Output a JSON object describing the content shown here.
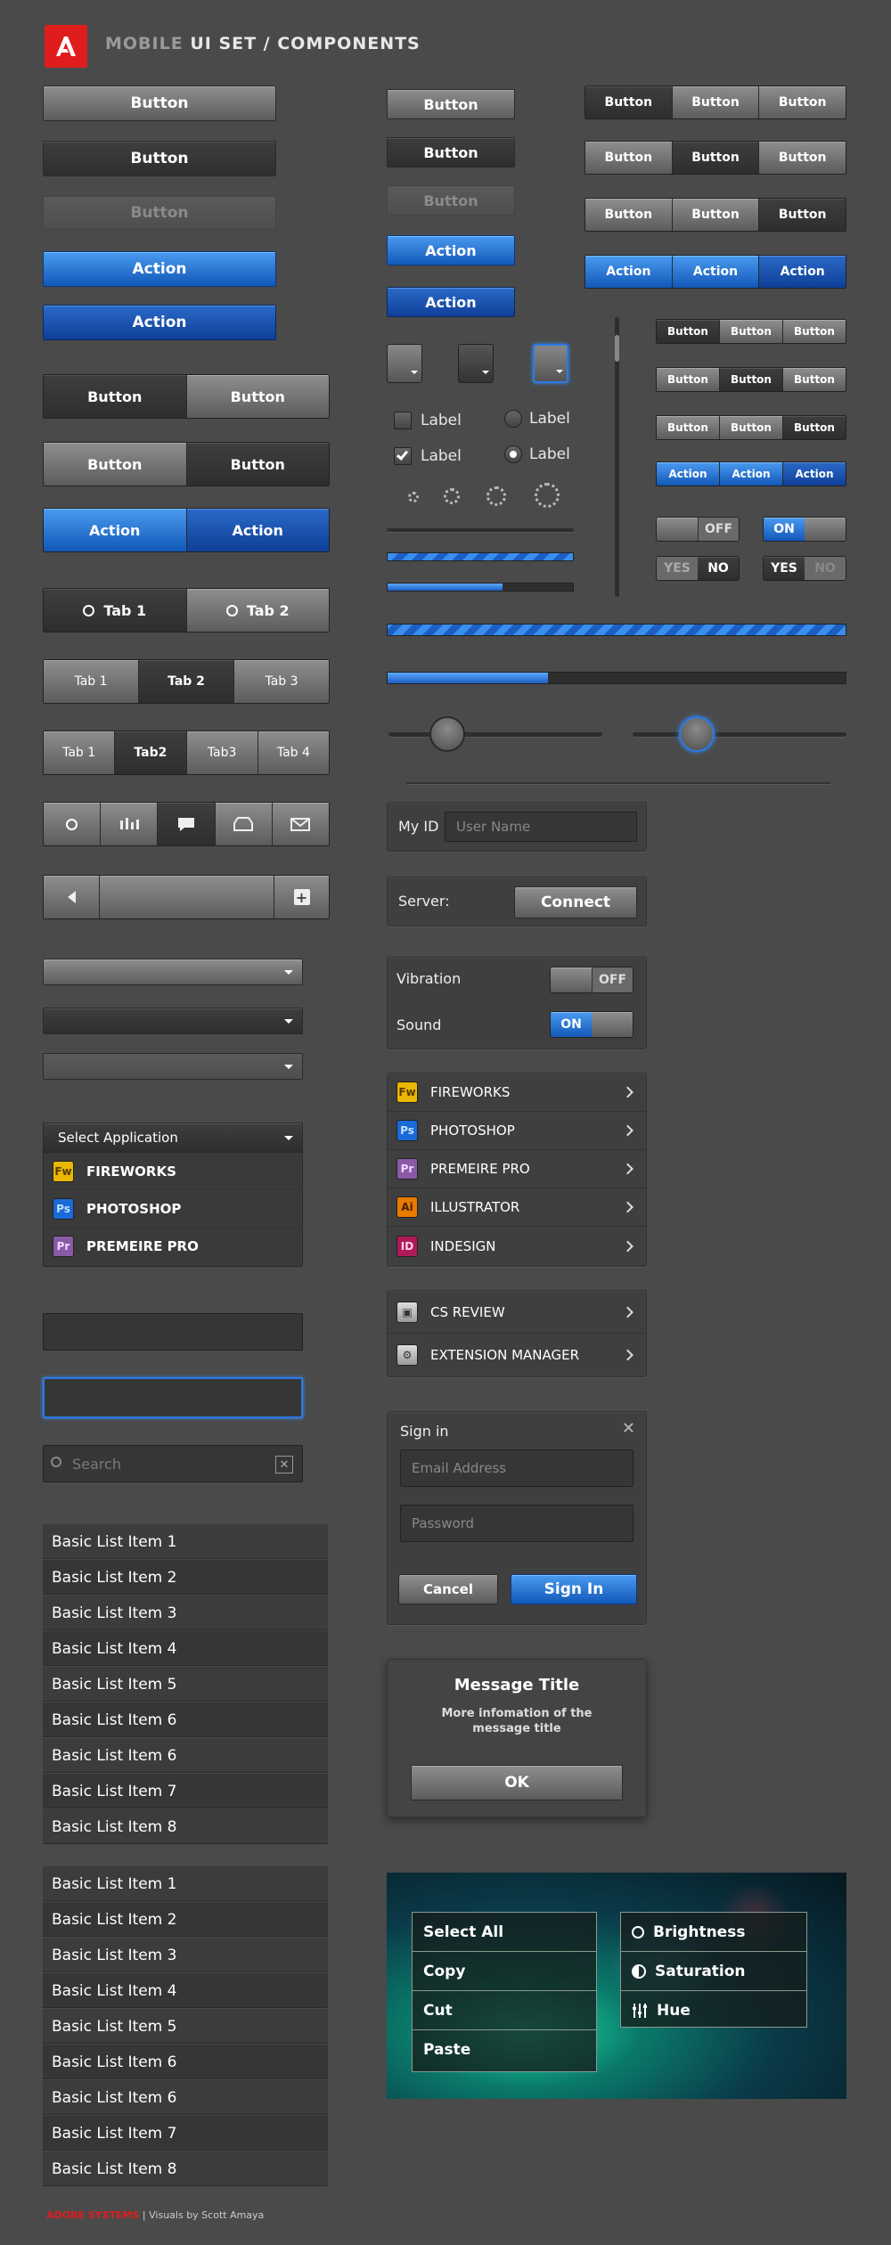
{
  "header": {
    "title_dim": "MOBILE",
    "title_rest": "UI SET / COMPONENTS"
  },
  "col1": {
    "buttons": [
      "Button",
      "Button",
      "Button",
      "Action",
      "Action"
    ],
    "seg1": [
      "Button",
      "Button"
    ],
    "seg2": [
      "Button",
      "Button"
    ],
    "seg3": [
      "Action",
      "Action"
    ],
    "tabs2": [
      "Tab 1",
      "Tab 2"
    ],
    "tabs3": [
      "Tab 1",
      "Tab 2",
      "Tab 3"
    ],
    "tabs4": [
      "Tab 1",
      "Tab2",
      "Tab3",
      "Tab 4"
    ],
    "select_label": "Select Application",
    "apps": [
      {
        "code": "Fw",
        "name": "FIREWORKS"
      },
      {
        "code": "Ps",
        "name": "PHOTOSHOP"
      },
      {
        "code": "Pr",
        "name": "PREMEIRE PRO"
      }
    ],
    "search_placeholder": "Search",
    "list1": [
      "Basic List Item 1",
      "Basic List Item 2",
      "Basic List Item 3",
      "Basic List Item 4",
      "Basic List Item 5",
      "Basic List Item 6",
      "Basic List Item 6",
      "Basic List Item 7",
      "Basic List Item 8"
    ],
    "list2": [
      "Basic List Item 1",
      "Basic List Item 2",
      "Basic List Item 3",
      "Basic List Item 4",
      "Basic List Item 5",
      "Basic List Item 6",
      "Basic List Item 6",
      "Basic List Item 7",
      "Basic List Item 8"
    ]
  },
  "col2": {
    "buttons": [
      "Button",
      "Button",
      "Button",
      "Action",
      "Action"
    ],
    "labels": [
      "Label",
      "Label",
      "Label",
      "Label"
    ],
    "myid_label": "My ID",
    "myid_placeholder": "User Name",
    "server_label": "Server:",
    "connect": "Connect",
    "vibration": "Vibration",
    "sound": "Sound",
    "apps": [
      {
        "code": "Fw",
        "name": "FIREWORKS"
      },
      {
        "code": "Ps",
        "name": "PHOTOSHOP"
      },
      {
        "code": "Pr",
        "name": "PREMEIRE PRO"
      },
      {
        "code": "Ai",
        "name": "ILLUSTRATOR"
      },
      {
        "code": "ID",
        "name": "INDESIGN"
      }
    ],
    "cs_review": "CS REVIEW",
    "ext_manager": "EXTENSION MANAGER",
    "signin": {
      "title": "Sign in",
      "email": "Email Address",
      "password": "Password",
      "cancel": "Cancel",
      "submit": "Sign In"
    },
    "message": {
      "title": "Message Title",
      "body": "More infomation of the message title",
      "ok": "OK"
    }
  },
  "col3": {
    "seg_rows": [
      [
        "Button",
        "Button",
        "Button"
      ],
      [
        "Button",
        "Button",
        "Button"
      ],
      [
        "Button",
        "Button",
        "Button"
      ],
      [
        "Action",
        "Action",
        "Action"
      ]
    ],
    "small_rows": [
      [
        "Button",
        "Button",
        "Button"
      ],
      [
        "Button",
        "Button",
        "Button"
      ],
      [
        "Button",
        "Button",
        "Button"
      ],
      [
        "Action",
        "Action",
        "Action"
      ]
    ],
    "off": "OFF",
    "on": "ON",
    "yes": "YES",
    "no": "NO"
  },
  "progress": {
    "small_fill": 0.62,
    "large_fill": 0.35
  },
  "context": {
    "edit": [
      "Select All",
      "Copy",
      "Cut",
      "Paste"
    ],
    "adjust": [
      "Brightness",
      "Saturation",
      "Hue"
    ]
  },
  "footer": {
    "brand": "ADOBE SYSTEMS",
    "credit": "Visuals by Scott Amaya"
  },
  "colors": {
    "accent_blue": "#1a6ad8",
    "brand_red": "#e01d1d",
    "bg": "#4a4a4a"
  }
}
